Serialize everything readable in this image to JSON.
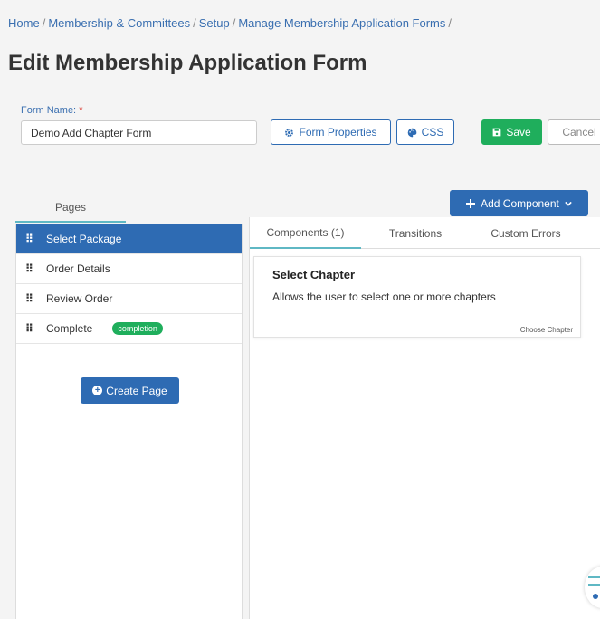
{
  "breadcrumb": [
    "Home",
    "Membership & Committees",
    "Setup",
    "Manage Membership Application Forms"
  ],
  "page_title": "Edit Membership Application Form",
  "form": {
    "name_label": "Form Name:",
    "required_mark": "*",
    "name_value": "Demo Add Chapter Form"
  },
  "toolbar": {
    "form_properties": "Form Properties",
    "css": "CSS",
    "save": "Save",
    "cancel": "Cancel",
    "add_component": "Add Component"
  },
  "left": {
    "tab": "Pages",
    "pages": [
      {
        "label": "Select Package",
        "active": true
      },
      {
        "label": "Order Details"
      },
      {
        "label": "Review Order"
      },
      {
        "label": "Complete",
        "badge": "completion"
      }
    ],
    "create_page": "Create Page"
  },
  "right": {
    "tabs": [
      "Components (1)",
      "Transitions",
      "Custom Errors"
    ],
    "component": {
      "title": "Select Chapter",
      "description": "Allows the user to select one or more chapters",
      "type": "Choose Chapter"
    }
  },
  "icons": {
    "form_properties": "gear-icon",
    "css": "palette-icon",
    "save": "floppy-disk-icon",
    "add_component": "plus-icon",
    "add_component_caret": "chevron-down-icon",
    "create_page": "plus-circle-icon",
    "drag": "drag-handle-icon",
    "help": "help-widget-icon"
  },
  "colors": {
    "primary": "#2e6bb3",
    "success": "#1fae5c",
    "accent": "#5fb8c4"
  }
}
